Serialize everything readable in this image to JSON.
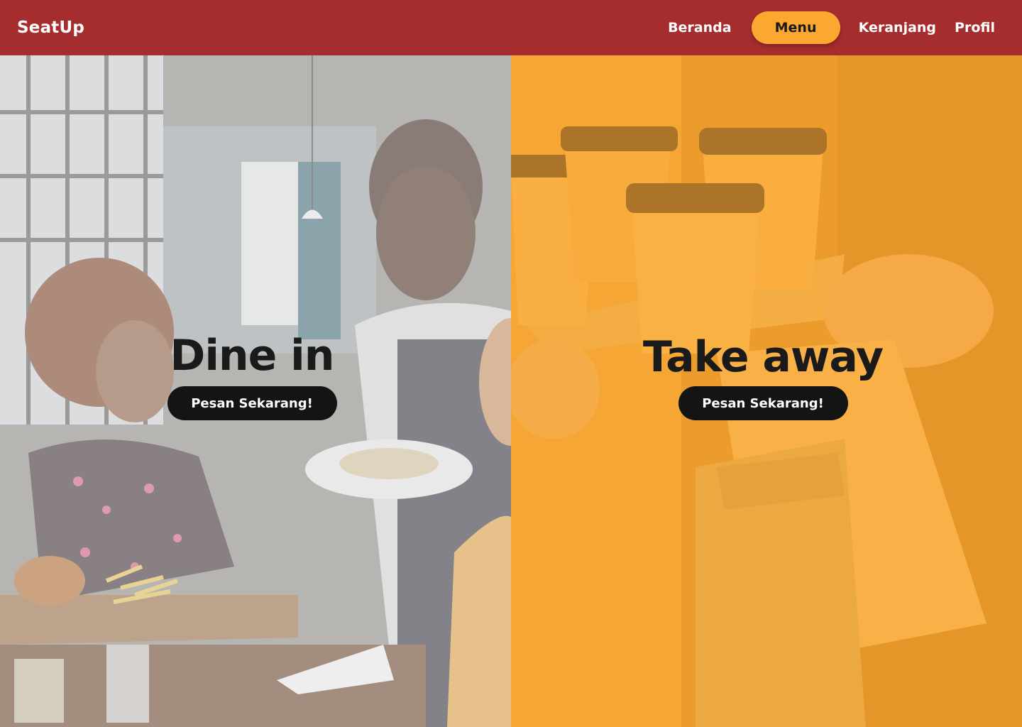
{
  "header": {
    "brand": "SeatUp",
    "nav": [
      "Beranda",
      "Menu",
      "Keranjang",
      "Profil"
    ],
    "active_nav": "Menu"
  },
  "options": [
    {
      "title": "Dine in",
      "button": "Pesan Sekarang!",
      "photo": "restaurant-waiter-serving-customers"
    },
    {
      "title": "Take away",
      "button": "Pesan Sekarang!",
      "photo": "hands-exchanging-coffee-cups-and-paper-bag"
    }
  ],
  "colors": {
    "header_bg": "#a62d2d",
    "accent": "#fba730",
    "button_bg": "#141414",
    "text_dark": "#1a1a1a"
  }
}
